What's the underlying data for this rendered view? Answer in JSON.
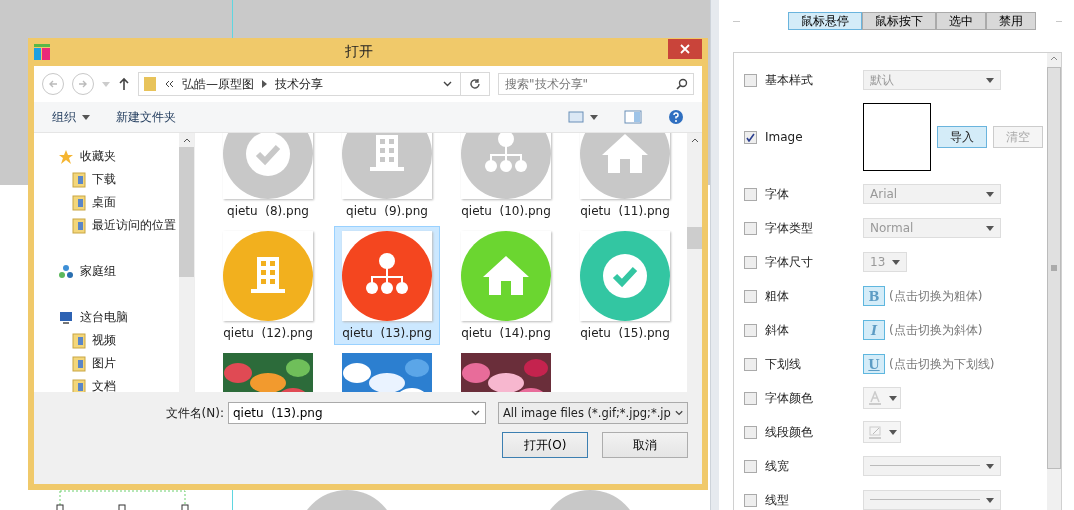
{
  "dialog": {
    "title": "打开",
    "address": {
      "path": [
        "弘皓—原型图",
        "技术分享"
      ]
    },
    "search": {
      "placeholder": "搜索\"技术分享\""
    },
    "commands": [
      {
        "label": "组织",
        "menu": true
      },
      {
        "label": "新建文件夹",
        "menu": false
      }
    ],
    "nav": [
      {
        "label": "收藏夹",
        "children": [
          {
            "label": "下载"
          },
          {
            "label": "桌面"
          },
          {
            "label": "最近访问的位置"
          }
        ]
      },
      {
        "label": "家庭组"
      },
      {
        "label": "这台电脑",
        "children": [
          {
            "label": "视频"
          },
          {
            "label": "图片"
          },
          {
            "label": "文档"
          }
        ]
      }
    ],
    "files": [
      {
        "name": "qietu  (8).png",
        "kind": "check",
        "color": "#c8c8c8",
        "selected": false
      },
      {
        "name": "qietu  (9).png",
        "kind": "building",
        "color": "#c8c8c8",
        "selected": false
      },
      {
        "name": "qietu  (10).png",
        "kind": "tree",
        "color": "#c8c8c8",
        "selected": false
      },
      {
        "name": "qietu  (11).png",
        "kind": "house",
        "color": "#c8c8c8",
        "selected": false
      },
      {
        "name": "qietu  (12).png",
        "kind": "building",
        "color": "#f2b01e",
        "selected": false
      },
      {
        "name": "qietu  (13).png",
        "kind": "tree",
        "color": "#f4461f",
        "selected": true
      },
      {
        "name": "qietu  (14).png",
        "kind": "house",
        "color": "#6bd630",
        "selected": false
      },
      {
        "name": "qietu  (15).png",
        "kind": "check",
        "color": "#33c6a2",
        "selected": false
      },
      {
        "kind": "picture"
      },
      {
        "kind": "picture"
      },
      {
        "kind": "picture"
      }
    ],
    "filename_label": "文件名(N):",
    "filename": "qietu  (13).png",
    "filetype": "All image files (*.gif;*.jpg;*.jp",
    "buttons": [
      {
        "label": "打开(O)",
        "default": true
      },
      {
        "label": "取消",
        "default": false
      }
    ]
  },
  "panel": {
    "tabs": [
      {
        "label": "鼠标悬停",
        "selected": true
      },
      {
        "label": "鼠标按下",
        "selected": false
      },
      {
        "label": "选中",
        "selected": false
      },
      {
        "label": "禁用",
        "selected": false
      }
    ],
    "properties": [
      {
        "kind": "select",
        "label": "基本样式",
        "checked": false,
        "value": "默认"
      },
      {
        "label": "Image",
        "checked": true,
        "buttons": [
          {
            "label": "导入",
            "disabled": false
          },
          {
            "label": "清空",
            "disabled": true
          }
        ]
      },
      {
        "kind": "select",
        "label": "字体",
        "checked": false,
        "value": "Arial"
      },
      {
        "kind": "select",
        "label": "字体类型",
        "checked": false,
        "value": "Normal"
      },
      {
        "kind": "small-select",
        "label": "字体尺寸",
        "checked": false,
        "value": "13"
      },
      {
        "kind": "toggle",
        "label": "粗体",
        "checked": false,
        "glyph": "B",
        "hint": "(点击切换为粗体)"
      },
      {
        "kind": "toggle",
        "label": "斜体",
        "checked": false,
        "glyph": "I",
        "hint": "(点击切换为斜体)"
      },
      {
        "kind": "toggle",
        "label": "下划线",
        "checked": false,
        "glyph": "U",
        "hint": "(点击切换为下划线)"
      },
      {
        "kind": "text-color",
        "label": "字体颜色",
        "checked": false
      },
      {
        "kind": "line-color",
        "label": "线段颜色",
        "checked": false
      },
      {
        "kind": "line",
        "label": "线宽",
        "checked": false
      },
      {
        "kind": "line",
        "label": "线型",
        "checked": false
      }
    ]
  }
}
